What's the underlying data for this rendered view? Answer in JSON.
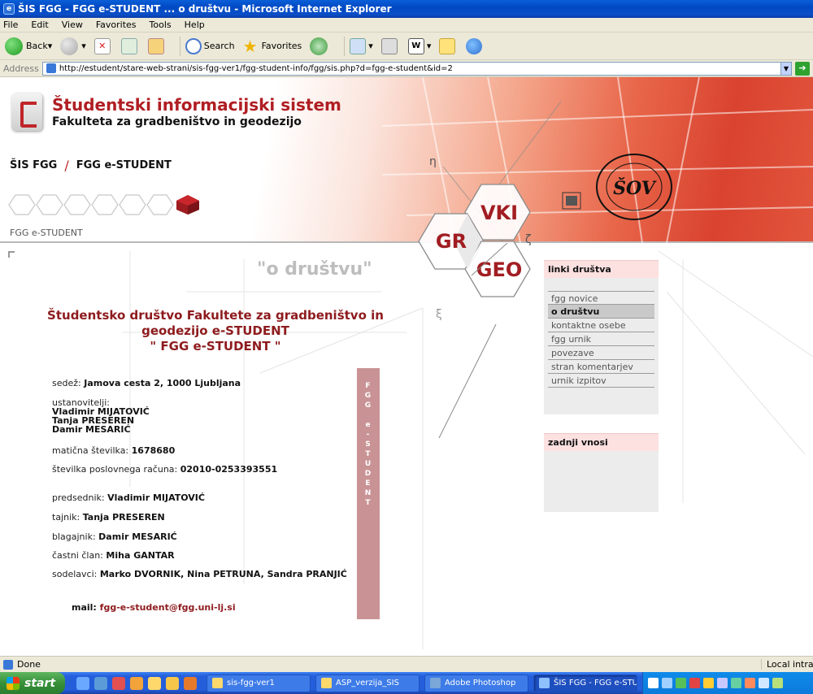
{
  "window": {
    "title": "ŠIS FGG - FGG e-STUDENT ... o društvu - Microsoft Internet Explorer"
  },
  "menu": [
    "File",
    "Edit",
    "View",
    "Favorites",
    "Tools",
    "Help"
  ],
  "toolbar": {
    "back": "Back",
    "search": "Search",
    "favorites": "Favorites"
  },
  "address": {
    "label": "Address",
    "url": "http://estudent/stare-web-strani/sis-fgg-ver1/fgg-student-info/fgg/sis.php?d=fgg-e-student&id=2"
  },
  "header": {
    "title": "Študentski informacijski sistem",
    "subtitle": "Fakulteta za gradbeništvo in geodezijo",
    "breadcrumb": [
      "ŠIS FGG",
      "FGG e-STUDENT"
    ],
    "label": "FGG e-STUDENT",
    "hex_labels": [
      "VKI",
      "GR",
      "GEO"
    ],
    "greek": [
      "η",
      "ζ",
      "ξ"
    ],
    "seal_text": "ŠOV"
  },
  "main": {
    "heading": "\"o društvu\"",
    "org_title": [
      "Študentsko društvo Fakultete za gradbeništvo in",
      "geodezijo e-STUDENT",
      "\"  FGG e-STUDENT \""
    ],
    "sedez_label": "sedež:",
    "sedez": "Jamova cesta 2, 1000 Ljubljana",
    "ustanovitelji_label": "ustanovitelji:",
    "ustanovitelji": [
      "Vladimir MIJATOVIĆ",
      "Tanja PRESEREN",
      "Damir MESARIĆ"
    ],
    "maticna_label": "matična številka:",
    "maticna": "1678680",
    "racun_label": "številka poslovnega računa:",
    "racun": "02010-0253393551",
    "predsednik_label": "predsednik:",
    "predsednik": "Vladimir MIJATOVIĆ",
    "tajnik_label": "tajnik:",
    "tajnik": "Tanja PRESEREN",
    "blagajnik_label": "blagajnik:",
    "blagajnik": "Damir MESARIĆ",
    "castni_label": "častni član:",
    "castni": "Miha GANTAR",
    "sodelavci_label": "sodelavci:",
    "sodelavci": "Marko DVORNIK, Nina PETRUNA, Sandra PRANJIĆ",
    "mail_label": "mail:",
    "mail": "fgg-e-student@fgg.uni-lj.si",
    "vertical_text": [
      "F",
      "G",
      "G",
      "",
      "e",
      "-",
      "S",
      "T",
      "U",
      "D",
      "E",
      "N",
      "T"
    ]
  },
  "sidebar": {
    "links_title": "linki društva",
    "links": [
      "fgg novice",
      "o društvu",
      "kontaktne osebe",
      "fgg urnik",
      "povezave",
      "stran komentarjev",
      "urnik izpitov"
    ],
    "active": "o društvu",
    "recent_title": "zadnji vnosi"
  },
  "status": {
    "text": "Done",
    "zone": "Local intranet"
  },
  "taskbar": {
    "start": "start",
    "tasks": [
      "sis-fgg-ver1",
      "ASP_verzija_SIS",
      "Adobe Photoshop",
      "ŠIS FGG - FGG e-STU..."
    ],
    "active_task": "ŠIS FGG - FGG e-STU..."
  },
  "colors": {
    "accent": "#b01e23",
    "panel_header": "#fde0e0",
    "vertical_bar": "#c99395"
  }
}
